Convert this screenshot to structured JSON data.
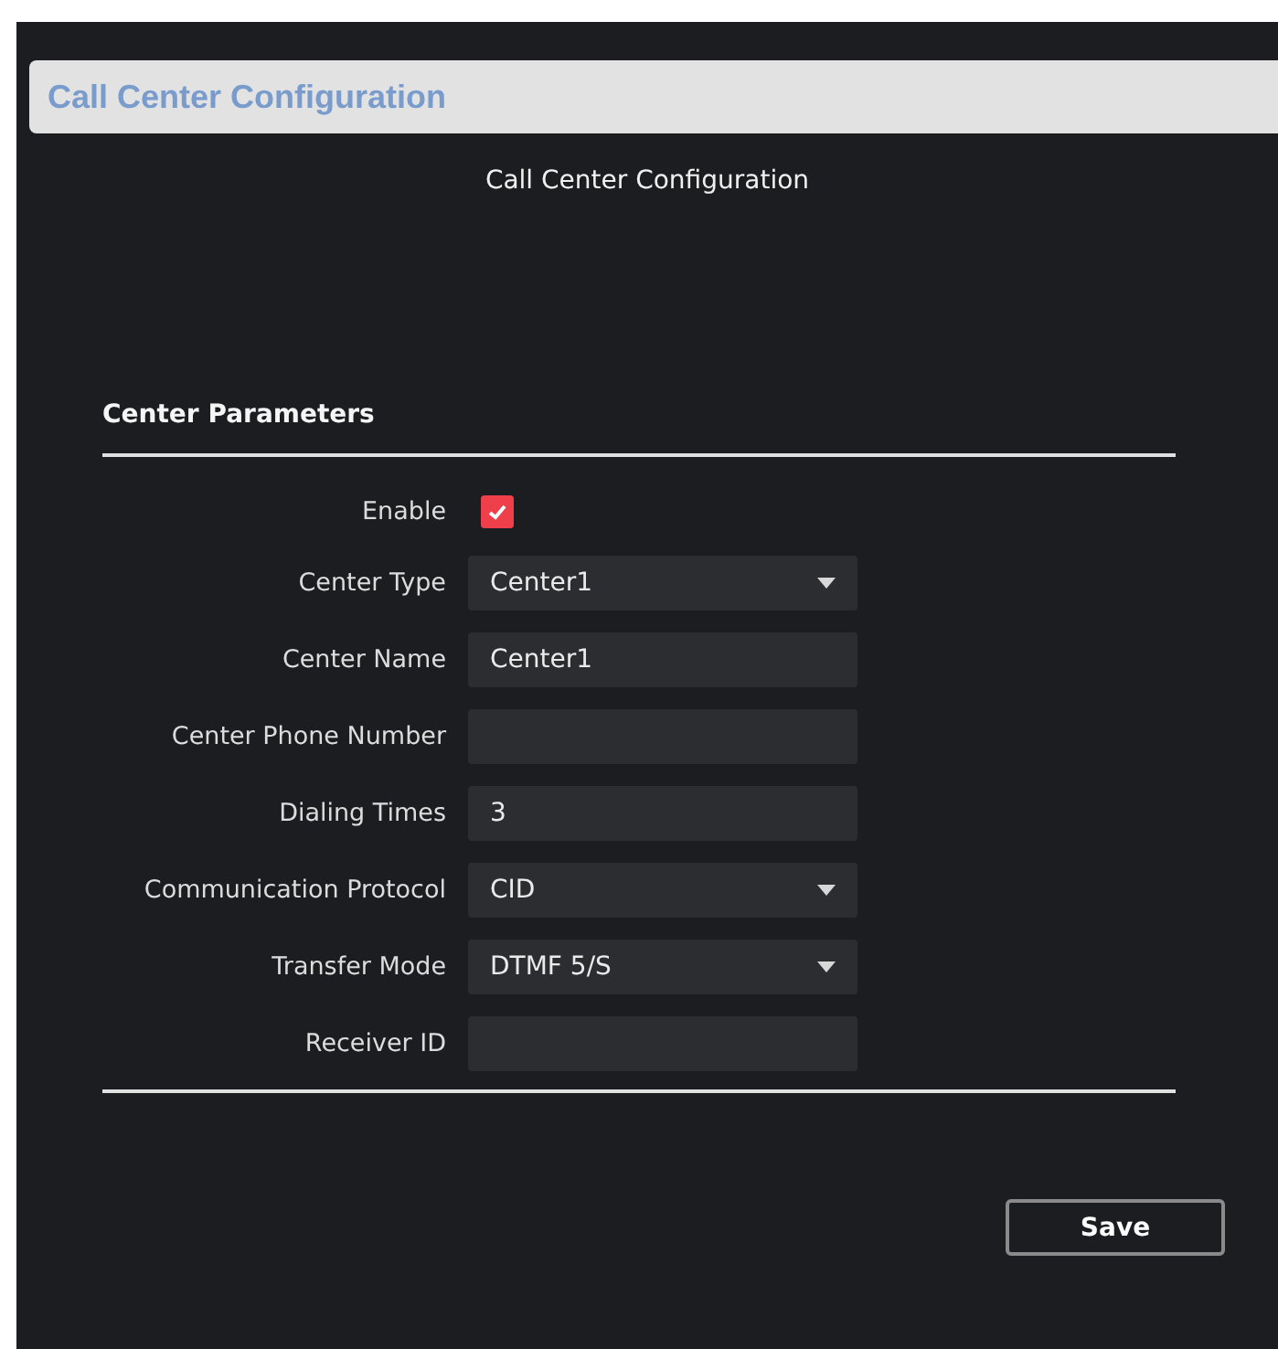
{
  "header": {
    "title": "Call Center Configuration"
  },
  "subtitle": "Call Center Configuration",
  "section": {
    "title": "Center Parameters"
  },
  "fields": [
    {
      "kind": "checkbox",
      "label": "Enable",
      "checked": true
    },
    {
      "kind": "select",
      "label": "Center Type",
      "value": "Center1"
    },
    {
      "kind": "text",
      "label": "Center Name",
      "value": "Center1"
    },
    {
      "kind": "text",
      "label": "Center Phone Number"
    },
    {
      "kind": "text",
      "label": "Dialing Times",
      "value": "3"
    },
    {
      "kind": "select",
      "label": "Communication Protocol",
      "value": "CID"
    },
    {
      "kind": "select",
      "label": "Transfer Mode",
      "value": "DTMF 5/S"
    },
    {
      "kind": "text",
      "label": "Receiver ID"
    }
  ],
  "buttons": [
    {
      "label": "Save"
    }
  ]
}
